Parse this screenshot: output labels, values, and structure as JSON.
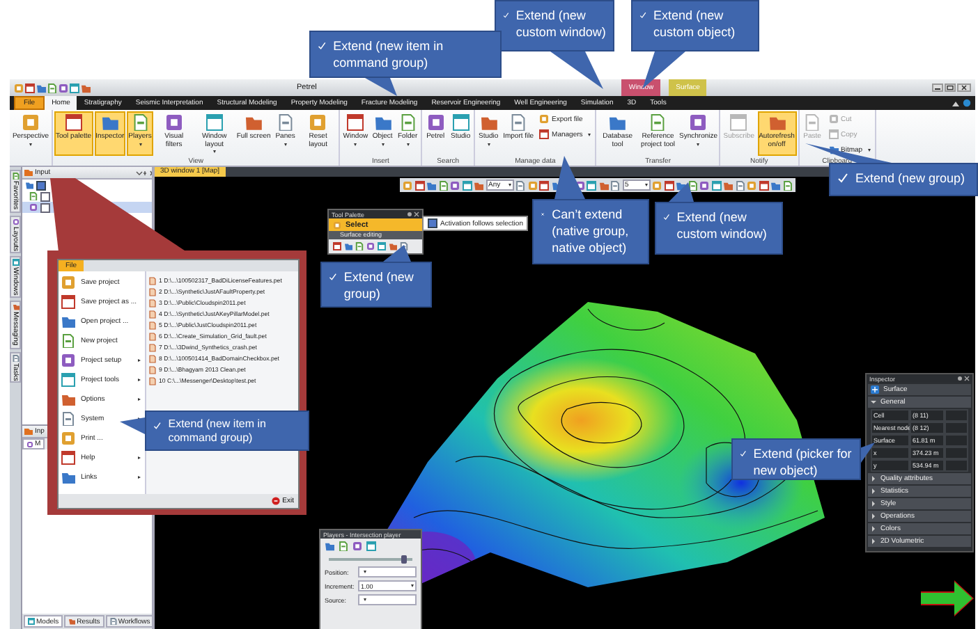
{
  "window": {
    "title": "Petrel"
  },
  "contextual_tabs": [
    {
      "label": "Window",
      "color": "#c9506e"
    },
    {
      "label": "Surface",
      "color": "#cfc24a"
    }
  ],
  "tabs": [
    {
      "label": "File",
      "kind": "file",
      "selected": false
    },
    {
      "label": "Home",
      "kind": "tab",
      "selected": true
    },
    {
      "label": "Stratigraphy",
      "kind": "tab",
      "selected": false
    },
    {
      "label": "Seismic Interpretation",
      "kind": "tab",
      "selected": false
    },
    {
      "label": "Structural Modeling",
      "kind": "tab",
      "selected": false
    },
    {
      "label": "Property Modeling",
      "kind": "tab",
      "selected": false
    },
    {
      "label": "Fracture Modeling",
      "kind": "tab",
      "selected": false
    },
    {
      "label": "Reservoir Engineering",
      "kind": "tab",
      "selected": false
    },
    {
      "label": "Well Engineering",
      "kind": "tab",
      "selected": false
    },
    {
      "label": "Simulation",
      "kind": "tab",
      "selected": false
    },
    {
      "label": "3D",
      "kind": "tab",
      "selected": false
    },
    {
      "label": "Tools",
      "kind": "tab",
      "selected": false
    }
  ],
  "ribbon_groups": [
    {
      "buttons": [
        {
          "label": "Perspective",
          "kind": "large",
          "dropdown": true,
          "active": false,
          "disabled": false
        }
      ]
    },
    {
      "label": "View",
      "buttons": [
        {
          "label": "Tool palette",
          "kind": "large",
          "dropdown": false,
          "active": true,
          "disabled": false
        },
        {
          "label": "Inspector",
          "kind": "large",
          "dropdown": false,
          "active": true,
          "disabled": false
        },
        {
          "label": "Players",
          "kind": "large",
          "dropdown": true,
          "active": true,
          "disabled": false
        },
        {
          "label": "Visual filters",
          "kind": "large",
          "dropdown": false,
          "active": false,
          "disabled": false
        },
        {
          "label": "Window layout",
          "kind": "large",
          "dropdown": true,
          "active": false,
          "disabled": false
        },
        {
          "label": "Full screen",
          "kind": "large",
          "dropdown": false,
          "active": false,
          "disabled": false
        },
        {
          "label": "Panes",
          "kind": "large",
          "dropdown": true,
          "active": false,
          "disabled": false
        },
        {
          "label": "Reset layout",
          "kind": "large",
          "dropdown": false,
          "active": false,
          "disabled": false
        }
      ]
    },
    {
      "label": "Insert",
      "buttons": [
        {
          "label": "Window",
          "kind": "large",
          "dropdown": true,
          "active": false,
          "disabled": false
        },
        {
          "label": "Object",
          "kind": "large",
          "dropdown": true,
          "active": false,
          "disabled": false
        },
        {
          "label": "Folder",
          "kind": "large",
          "dropdown": true,
          "active": false,
          "disabled": false
        }
      ]
    },
    {
      "label": "Search",
      "buttons": [
        {
          "label": "Petrel",
          "kind": "large",
          "dropdown": false,
          "active": false,
          "disabled": false
        },
        {
          "label": "Studio",
          "kind": "large",
          "dropdown": false,
          "active": false,
          "disabled": false
        }
      ]
    },
    {
      "label": "Manage data",
      "buttons": [
        {
          "label": "Studio",
          "kind": "large",
          "dropdown": true,
          "active": false,
          "disabled": false
        },
        {
          "label": "Import file",
          "kind": "large",
          "dropdown": false,
          "active": false,
          "disabled": false
        },
        {
          "label": "Export file",
          "kind": "small",
          "dropdown": false,
          "active": false,
          "disabled": false
        },
        {
          "label": "Managers",
          "kind": "small",
          "dropdown": true,
          "active": false,
          "disabled": false
        }
      ]
    },
    {
      "label": "Transfer",
      "buttons": [
        {
          "label": "Database tool",
          "kind": "large",
          "dropdown": false,
          "active": false,
          "disabled": false
        },
        {
          "label": "Reference project tool",
          "kind": "large",
          "dropdown": false,
          "active": false,
          "disabled": false
        },
        {
          "label": "Synchronize",
          "kind": "large",
          "dropdown": true,
          "active": false,
          "disabled": false
        }
      ]
    },
    {
      "label": "Notify",
      "buttons": [
        {
          "label": "Subscribe",
          "kind": "large",
          "dropdown": false,
          "active": false,
          "disabled": true
        },
        {
          "label": "Autorefresh on/off",
          "kind": "large",
          "dropdown": false,
          "active": true,
          "disabled": false
        }
      ]
    },
    {
      "label": "Clipboard",
      "buttons": [
        {
          "label": "Paste",
          "kind": "large",
          "dropdown": false,
          "active": false,
          "disabled": true
        },
        {
          "label": "Cut",
          "kind": "small",
          "dropdown": false,
          "active": false,
          "disabled": true
        },
        {
          "label": "Copy",
          "kind": "small",
          "dropdown": false,
          "active": false,
          "disabled": true
        },
        {
          "label": "Bitmap",
          "kind": "small",
          "dropdown": true,
          "active": false,
          "disabled": false
        }
      ]
    }
  ],
  "side_tabs": [
    "Favorites",
    "Layouts",
    "Windows",
    "Messaging",
    "Tasks"
  ],
  "input_pane": {
    "title": "Input",
    "tree": [
      {
        "checked": true,
        "selected": false
      },
      {
        "checked": false,
        "selected": false
      },
      {
        "checked": false,
        "selected": true
      }
    ]
  },
  "lower_pane": {
    "title": "Inp",
    "tab": "M"
  },
  "bottom_tabs": [
    {
      "label": "Models",
      "selected": true
    },
    {
      "label": "Results",
      "selected": false
    },
    {
      "label": "Workflows",
      "selected": false
    }
  ],
  "viewport": {
    "tab": "3D window 1 [Map]",
    "toolbar_fields": [
      "Any",
      "5"
    ]
  },
  "tool_palette": {
    "title": "Tool Palette",
    "tool": "Select",
    "section": "Surface editing",
    "tooltip": {
      "text": "Activation follows selection",
      "checked": true
    }
  },
  "inspector": {
    "title": "Inspector",
    "object": "Surface",
    "sections": [
      {
        "label": "General",
        "expanded": true,
        "rows": [
          {
            "name": "Cell",
            "value": "(8 11)"
          },
          {
            "name": "Nearest node",
            "value": "(8 12)"
          },
          {
            "name": "Surface",
            "value": "61.81 m"
          },
          {
            "name": "x",
            "value": "374.23 m"
          },
          {
            "name": "y",
            "value": "534.94 m"
          }
        ]
      },
      {
        "label": "Quality attributes",
        "expanded": false
      },
      {
        "label": "Statistics",
        "expanded": false
      },
      {
        "label": "Style",
        "expanded": false
      },
      {
        "label": "Operations",
        "expanded": false
      },
      {
        "label": "Colors",
        "expanded": false
      },
      {
        "label": "2D Volumetric",
        "expanded": false
      }
    ]
  },
  "players": {
    "title": "Players - Intersection player",
    "slider": {
      "level": 0.9
    },
    "position_label": "Position:",
    "increment_label": "Increment:",
    "increment": "1.00",
    "source_label": "Source:"
  },
  "file_menu": {
    "tab": "File",
    "items": [
      {
        "label": "Save project",
        "submenu": false
      },
      {
        "label": "Save project as ...",
        "submenu": false
      },
      {
        "label": "Open project ...",
        "submenu": false
      },
      {
        "label": "New project",
        "submenu": false
      },
      {
        "label": "Project setup",
        "submenu": true
      },
      {
        "label": "Project tools",
        "submenu": true
      },
      {
        "label": "Options",
        "submenu": true
      },
      {
        "label": "System",
        "submenu": true
      },
      {
        "label": "Print ...",
        "submenu": false
      },
      {
        "label": "Help",
        "submenu": true
      },
      {
        "label": "Links",
        "submenu": true
      }
    ],
    "recent": [
      "1 D:\\...\\100502317_BadDiLicenseFeatures.pet",
      "2 D:\\...\\Synthetic\\JustAFaultProperty.pet",
      "3 D:\\...\\Public\\Cloudspin2011.pet",
      "4 D:\\...\\Synthetic\\JustAKeyPillarModel.pet",
      "5 D:\\...\\Public\\JustCloudspin2011.pet",
      "6 D:\\...\\Create_Simulation_Grid_fault.pet",
      "7 D:\\...\\3Dwind_Synthetics_crash.pet",
      "8 D:\\...\\100501414_BadDomainCheckbox.pet",
      "9 D:\\...\\Bhagyam 2013 Clean.pet",
      "10 C:\\...\\Messenger\\Desktop\\test.pet"
    ],
    "exit": "Exit"
  },
  "callouts": [
    {
      "kind": "extend",
      "text": "Extend (new custom window)"
    },
    {
      "kind": "extend",
      "text": "Extend (new custom object)"
    },
    {
      "kind": "extend",
      "text": "Extend (new item in command group)"
    },
    {
      "kind": "extend",
      "text": "Extend (new group)"
    },
    {
      "kind": "cannot",
      "text": "Can’t extend (native group, native object)"
    },
    {
      "kind": "extend",
      "text": "Extend (new custom window)"
    },
    {
      "kind": "extend",
      "text": "Extend (new group)"
    },
    {
      "kind": "extend",
      "text": "Extend (new item in command group)"
    },
    {
      "kind": "extend",
      "text": "Extend (picker for new object)"
    }
  ]
}
